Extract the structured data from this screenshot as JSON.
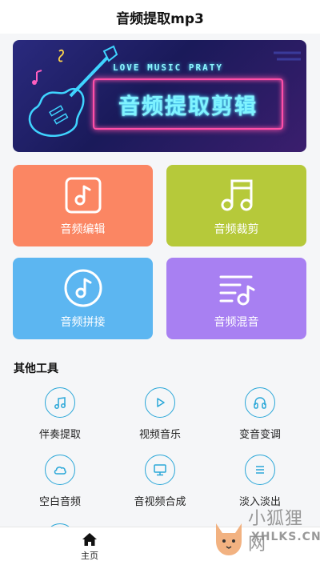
{
  "header": {
    "title": "音频提取mp3"
  },
  "banner": {
    "tagline": "LOVE MUSIC PRATY",
    "title": "音频提取剪辑"
  },
  "tiles": [
    {
      "label": "音频编辑",
      "color": "#fb8663",
      "icon": "music-note-square-icon"
    },
    {
      "label": "音频裁剪",
      "color": "#b6c93a",
      "icon": "music-notes-icon"
    },
    {
      "label": "音频拼接",
      "color": "#5cb6f1",
      "icon": "music-note-circle-icon"
    },
    {
      "label": "音频混音",
      "color": "#a880f2",
      "icon": "playlist-music-icon"
    }
  ],
  "section": {
    "title": "其他工具"
  },
  "tools": [
    {
      "label": "伴奏提取",
      "icon": "music-notes-icon"
    },
    {
      "label": "视频音乐",
      "icon": "play-icon"
    },
    {
      "label": "变音变调",
      "icon": "headphones-icon"
    },
    {
      "label": "空白音频",
      "icon": "cloud-icon"
    },
    {
      "label": "音视频合成",
      "icon": "monitor-icon"
    },
    {
      "label": "淡入淡出",
      "icon": "list-icon"
    }
  ],
  "tabbar": {
    "home_label": "主页",
    "home_icon": "home-icon"
  },
  "watermark": {
    "cn": "小狐狸网",
    "en": "XHLKS.CN"
  },
  "colors": {
    "accent": "#2aa7d8",
    "background": "#f5f6f8"
  }
}
